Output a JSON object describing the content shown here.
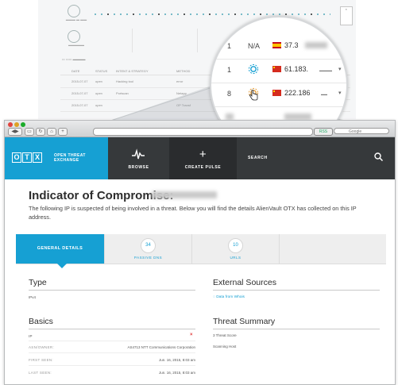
{
  "background_dashboard": {
    "table_headers": [
      "DATE",
      "STATUS",
      "INTENT & STRATEGY",
      "METHOD"
    ],
    "rows": [
      {
        "date": "2015-07-07",
        "status": "open",
        "intent": "Hacking tool",
        "method": "error"
      },
      {
        "date": "2015-07-07",
        "status": "open",
        "intent": "Portscan",
        "method": "Netapp"
      },
      {
        "date": "2015-07-07",
        "status": "open",
        "intent": "",
        "method": "OP Transf"
      }
    ]
  },
  "magnifier": {
    "rows": [
      {
        "num": "1",
        "reputation": "N/A",
        "ip": "37.3"
      },
      {
        "num": "1",
        "reputation": "",
        "ip": "61.183."
      },
      {
        "num": "8",
        "reputation": "",
        "ip": "222.186"
      }
    ],
    "colors": {
      "icon": "#16a0d3",
      "highlight_icon": "#e8a13a"
    }
  },
  "browser": {
    "search_placeholder": "Google"
  },
  "header": {
    "brand_line1": "OPEN THREAT",
    "brand_line2": "EXCHANGE",
    "logo_letters": [
      "O",
      "T",
      "X"
    ],
    "nav": {
      "browse": "BROWSE",
      "create_pulse": "CREATE PULSE",
      "search": "SEARCH"
    },
    "colors": {
      "brand": "#16a0d3",
      "bar": "#36393b",
      "active": "#2a2c2e"
    }
  },
  "page": {
    "title": "Indicator of Compromise:",
    "description": "The following IP is suspected of being involved in a threat.  Below you will find the details AlienVault OTX has collected on this IP address."
  },
  "tabs": [
    {
      "label": "GENERAL DETAILS",
      "count": ""
    },
    {
      "label": "PASSIVE DNS",
      "count": "34"
    },
    {
      "label": "URLS",
      "count": "10"
    }
  ],
  "type_section": {
    "heading": "Type",
    "value": "IPv4"
  },
  "basics": {
    "heading": "Basics",
    "ip_label": "IP",
    "rows": [
      {
        "label": "ASN/OWNER:",
        "value": "AS4713 NTT Communications Corporation"
      },
      {
        "label": "FIRST SEEN:",
        "value": "Jun. 16, 2015, 8:03 am"
      },
      {
        "label": "LAST SEEN:",
        "value": "Jun. 16, 2015, 8:03 am"
      }
    ]
  },
  "external_sources": {
    "heading": "External Sources",
    "link": "Data from Whois"
  },
  "threat_summary": {
    "heading": "Threat Summary",
    "lines": [
      "3 Threat Score",
      "Scanning Host"
    ]
  }
}
